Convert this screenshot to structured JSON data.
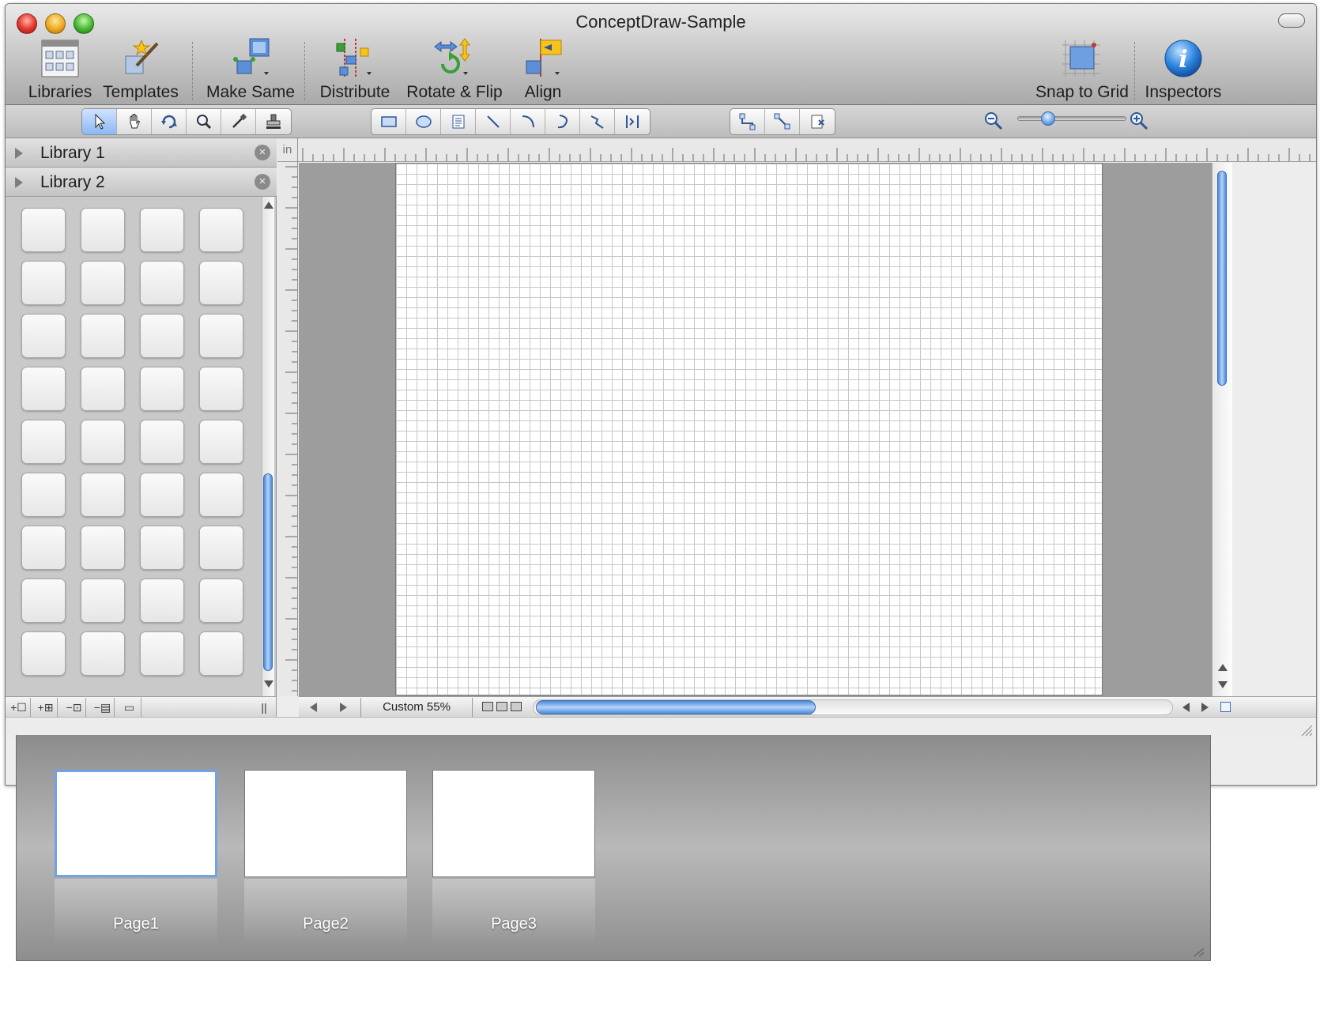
{
  "window": {
    "title": "ConceptDraw-Sample"
  },
  "toolbar": {
    "libraries": "Libraries",
    "templates": "Templates",
    "make_same": "Make Same",
    "distribute": "Distribute",
    "rotate_flip": "Rotate & Flip",
    "align": "Align",
    "snap_to_grid": "Snap to Grid",
    "inspectors": "Inspectors"
  },
  "tools": {
    "left_group": [
      "pointer-icon",
      "hand-icon",
      "rotate-icon",
      "magnifier-icon",
      "eyedropper-icon",
      "stamp-icon"
    ],
    "shape_group": [
      "rectangle-icon",
      "ellipse-icon",
      "text-box-icon",
      "line-icon",
      "arc-icon",
      "curve-icon",
      "polyline-icon",
      "bezier-icon"
    ],
    "connector_group": [
      "orthogonal-connector-icon",
      "direct-connector-icon",
      "connection-point-icon"
    ]
  },
  "libraries": [
    {
      "name": "Library 1"
    },
    {
      "name": "Library 2"
    }
  ],
  "ruler": {
    "unit": "in"
  },
  "canvas": {
    "zoom_label": "Custom 55%"
  },
  "pages": [
    {
      "label": "Page1",
      "selected": true
    },
    {
      "label": "Page2",
      "selected": false
    },
    {
      "label": "Page3",
      "selected": false
    }
  ],
  "colors": {
    "accent": "#6ea3e8",
    "scroll_thumb": "#4b88d9"
  }
}
